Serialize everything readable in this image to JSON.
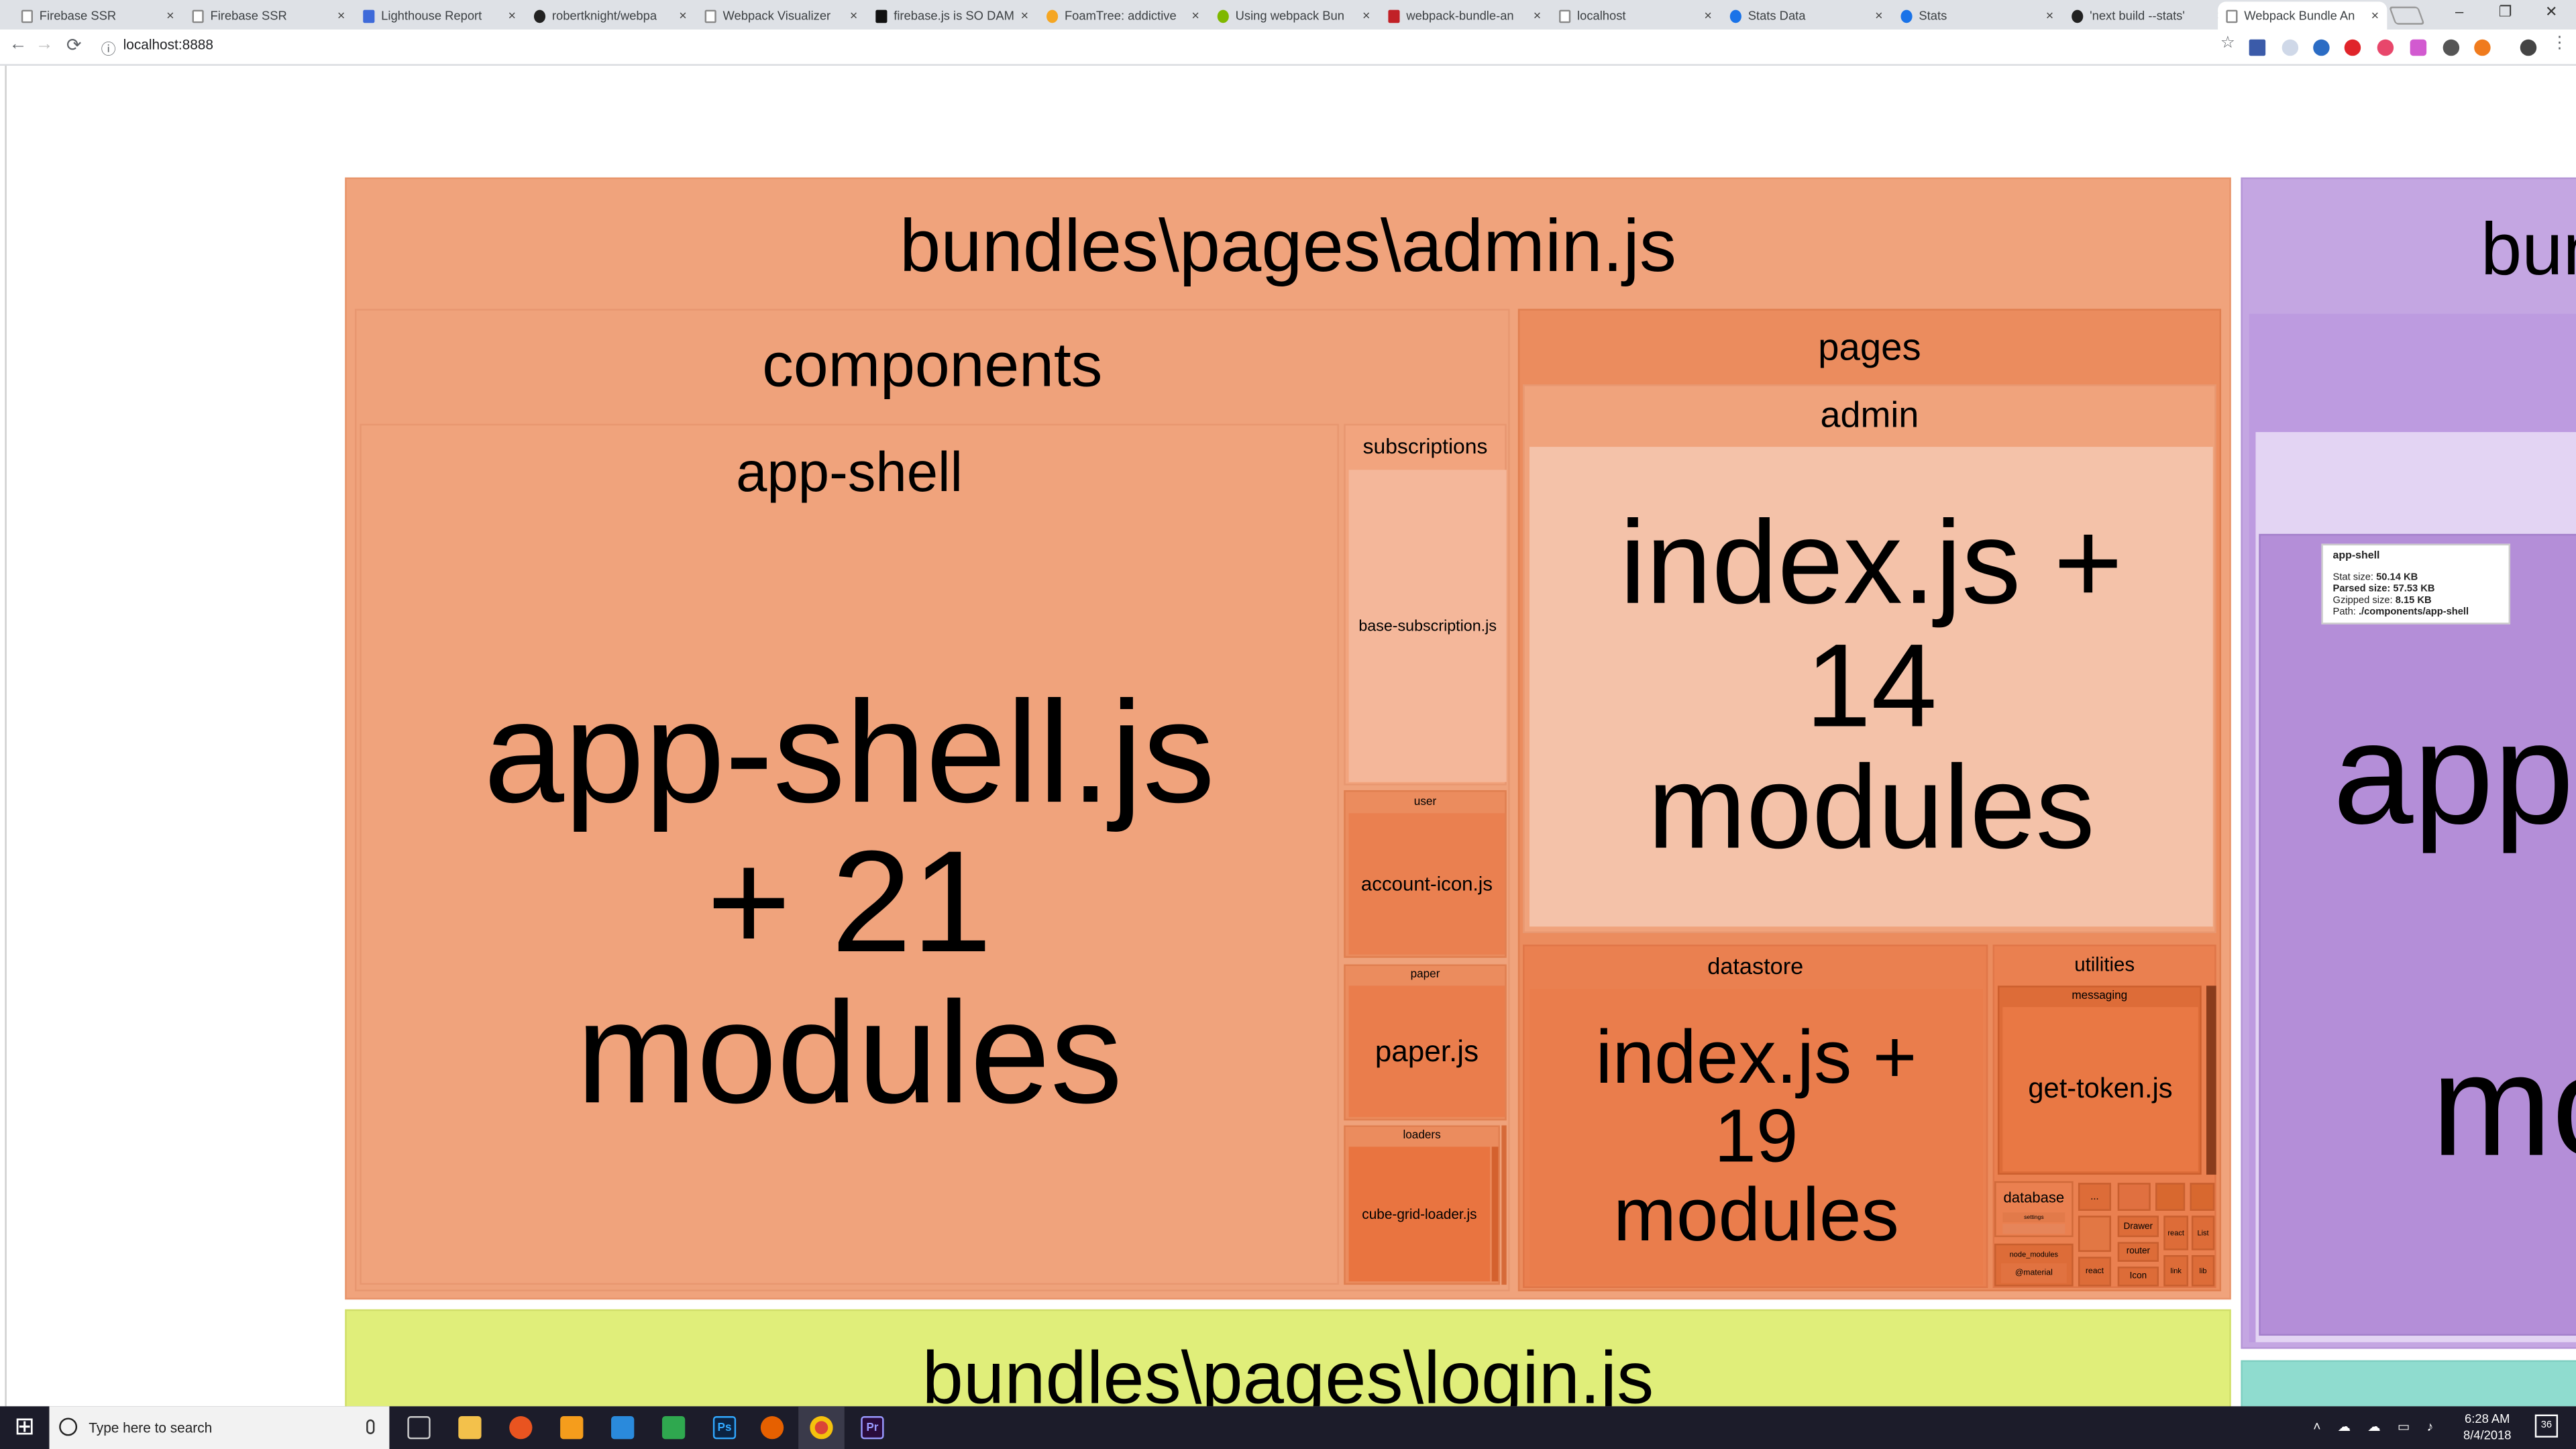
{
  "browser": {
    "tabs": [
      {
        "title": "Firebase SSR"
      },
      {
        "title": "Firebase SSR"
      },
      {
        "title": "Lighthouse Report"
      },
      {
        "title": "robertknight/webpa"
      },
      {
        "title": "Webpack Visualizer"
      },
      {
        "title": "firebase.js is SO DAM"
      },
      {
        "title": "FoamTree: addictive"
      },
      {
        "title": "Using webpack Bun"
      },
      {
        "title": "webpack-bundle-an"
      },
      {
        "title": "localhost"
      },
      {
        "title": "Stats Data"
      },
      {
        "title": "Stats"
      },
      {
        "title": "'next build --stats'"
      },
      {
        "title": "Webpack Bundle An"
      }
    ],
    "close_glyph": "×",
    "url": "localhost:8888",
    "nav": {
      "back": "←",
      "forward": "→",
      "reload": "⟳",
      "info": "ⓘ"
    },
    "window_controls": {
      "minimize": "–",
      "maximize": "❐",
      "close": "✕"
    },
    "star": "☆",
    "menu": "⋮"
  },
  "treemap": {
    "admin_bundle": {
      "label": "bundles\\pages\\admin.js",
      "color": "#f0a37c",
      "components": {
        "label": "components",
        "app_shell": {
          "label": "app-shell",
          "file": "app-shell.js + 21 modules"
        },
        "subscriptions": {
          "label": "subscriptions",
          "file": "base-subscription.js"
        },
        "user": {
          "label": "user",
          "file": "account-icon.js"
        },
        "paper": {
          "label": "paper",
          "file": "paper.js"
        },
        "loaders": {
          "label": "loaders",
          "file": "cube-grid-loader.js"
        }
      },
      "pages": {
        "label": "pages",
        "admin": {
          "label": "admin",
          "file": "index.js + 14 modules"
        },
        "datastore": {
          "label": "datastore",
          "file": "index.js + 19 modules"
        },
        "utilities": {
          "label": "utilities",
          "messaging": {
            "label": "messaging",
            "file": "get-token.js"
          },
          "database": "database",
          "settings": "settings",
          "ellipsis": "...",
          "node_modules": "node_modules",
          "material": "@material",
          "drawer": "Drawer",
          "react": "react",
          "list": "List",
          "router": "router",
          "icon": "Icon",
          "link": "link",
          "react_small": "react",
          "lib": "lib"
        }
      }
    },
    "login_bundle": {
      "label": "bundles\\pages\\login.js",
      "color": "#e0ee7a"
    },
    "right_bundle": {
      "label": "bun",
      "big_a": "app",
      "big_b": "mo",
      "color": "#c4a6e2"
    }
  },
  "tooltip": {
    "title": "app-shell",
    "stat_label": "Stat size:",
    "stat_value": "50.14 KB",
    "parsed_label": "Parsed size:",
    "parsed_value": "57.53 KB",
    "gzip_label": "Gzipped size:",
    "gzip_value": "8.15 KB",
    "path_label": "Path:",
    "path_value": "./components/app-shell"
  },
  "taskbar": {
    "search_placeholder": "Type here to search",
    "time": "6:28 AM",
    "date": "8/4/2018",
    "notifications": "36",
    "start_glyph": "⊞"
  }
}
